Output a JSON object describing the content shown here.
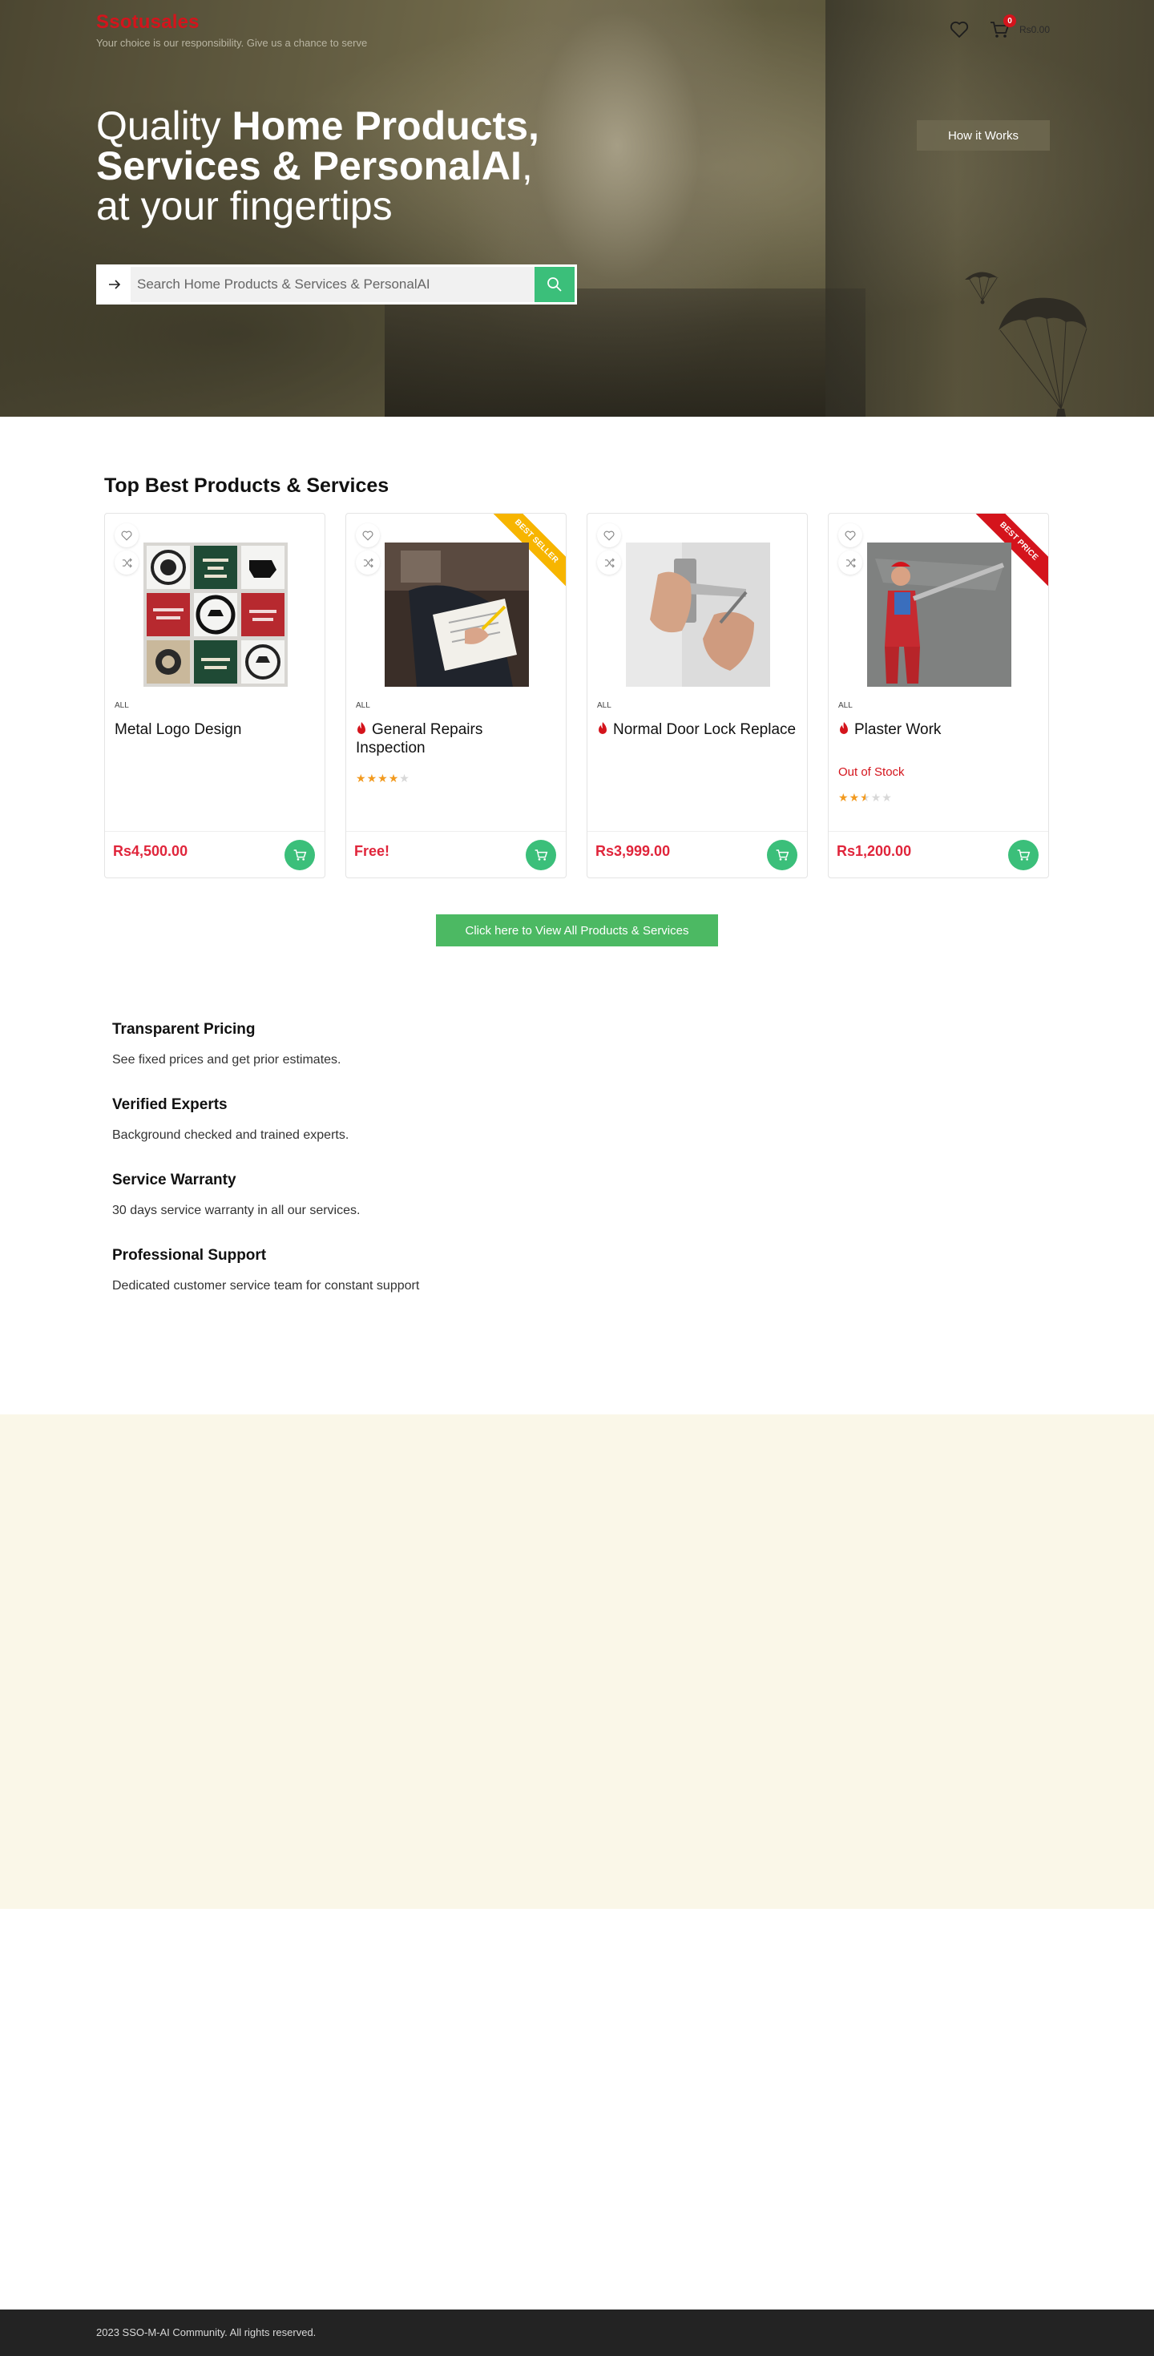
{
  "header": {
    "brand_name": "Ssotusales",
    "brand_tagline": "Your choice is our responsibility. Give us a chance to serve",
    "cart_count": "0",
    "cart_total": "Rs0.00"
  },
  "hero": {
    "title_line1_normal": "Quality ",
    "title_line1_bold": "Home Products,",
    "title_line2_bold": "Services & PersonalAI",
    "title_line2_normal": ",",
    "title_line3": "at your fingertips",
    "how_it_works_label": "How it Works",
    "search_placeholder": "Search Home Products & Services & PersonalAI"
  },
  "products": {
    "section_title": "Top Best Products & Services",
    "items": [
      {
        "category": "ALL",
        "name": "Metal Logo Design",
        "price": "Rs4,500.00",
        "stock": "",
        "rating": 0,
        "ribbon": ""
      },
      {
        "category": "ALL",
        "name": "General Repairs Inspection",
        "price": "Free!",
        "stock": "",
        "rating": 4,
        "ribbon": "BEST SELLER"
      },
      {
        "category": "ALL",
        "name": "Normal Door Lock Replace",
        "price": "Rs3,999.00",
        "stock": "",
        "rating": 0,
        "ribbon": ""
      },
      {
        "category": "ALL",
        "name": "Plaster Work",
        "price": "Rs1,200.00",
        "stock": "Out of Stock",
        "rating": 2.5,
        "ribbon": "BEST PRICE"
      }
    ],
    "view_all_label": "Click here to View All Products & Services"
  },
  "features": [
    {
      "title": "Transparent Pricing",
      "desc": "See fixed prices and get prior estimates."
    },
    {
      "title": "Verified Experts",
      "desc": "Background checked and trained experts."
    },
    {
      "title": "Service Warranty",
      "desc": "30 days service warranty in all our services."
    },
    {
      "title": "Professional Support",
      "desc": "Dedicated customer service team for constant support"
    }
  ],
  "footer": {
    "copyright": "2023 SSO-M-AI Community. All rights reserved."
  },
  "colors": {
    "brand_red": "#d4141c",
    "accent_green": "#3bbf7a",
    "price_red": "#e0253b",
    "ribbon_yellow": "#f7b500",
    "cream_band": "#faf7e8",
    "footer_bg": "#232323"
  },
  "icons": [
    "heart-icon",
    "cart-icon",
    "arrow-right-icon",
    "search-icon",
    "compare-icon",
    "flame-icon",
    "add-to-cart-icon",
    "star-icon"
  ]
}
